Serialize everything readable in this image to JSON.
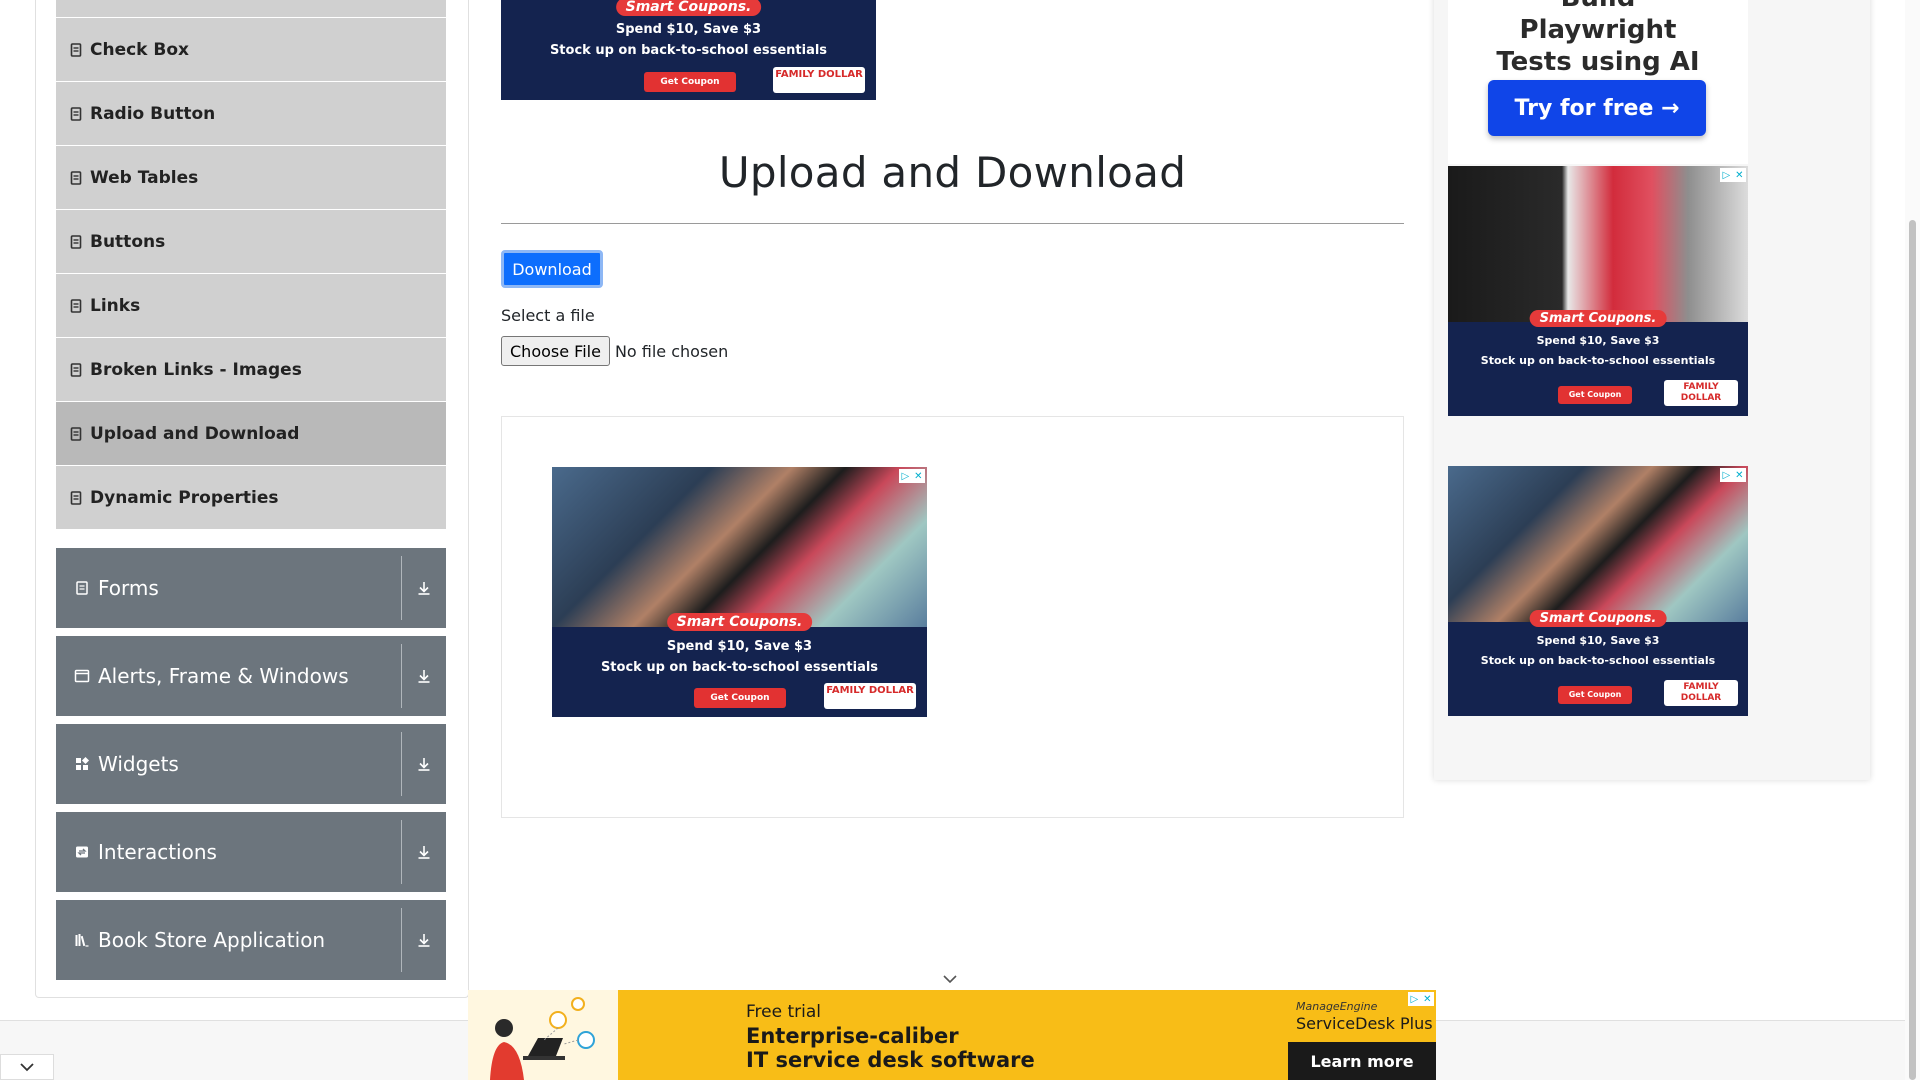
{
  "sidebar": {
    "elements_items": [
      {
        "label": "",
        "active": false
      },
      {
        "label": "Check Box",
        "active": false
      },
      {
        "label": "Radio Button",
        "active": false
      },
      {
        "label": "Web Tables",
        "active": false
      },
      {
        "label": "Buttons",
        "active": false
      },
      {
        "label": "Links",
        "active": false
      },
      {
        "label": "Broken Links - Images",
        "active": false
      },
      {
        "label": "Upload and Download",
        "active": true
      },
      {
        "label": "Dynamic Properties",
        "active": false
      }
    ],
    "groups": [
      {
        "label": "Forms",
        "icon": "form-icon"
      },
      {
        "label": "Alerts, Frame & Windows",
        "icon": "window-icon"
      },
      {
        "label": "Widgets",
        "icon": "widgets-icon"
      },
      {
        "label": "Interactions",
        "icon": "interactions-icon"
      },
      {
        "label": "Book Store Application",
        "icon": "books-icon"
      }
    ]
  },
  "main": {
    "title": "Upload and Download",
    "download_button": "Download",
    "select_label": "Select a file",
    "choose_file": "Choose File",
    "no_file": "No file chosen"
  },
  "ads": {
    "coupon_pill": "Smart Coupons.",
    "spend_line": "Spend $10, Save $3",
    "stock_line": "Stock up on back-to-school essentials",
    "get_coupon": "Get Coupon",
    "logo_text": "FAMILY DOLLAR"
  },
  "right_promo": {
    "headline": "Build Playwright Tests using AI",
    "button": "Try for free →"
  },
  "bottom_ad": {
    "free_trial": "Free trial",
    "headline_line1": "Enterprise-caliber",
    "headline_line2": "IT service desk software",
    "brand_small": "ManageEngine",
    "brand": "ServiceDesk Plus",
    "cta": "Learn more"
  },
  "colors": {
    "accent": "#0d6efd",
    "sidebar_item": "#d0d0d0",
    "sidebar_active": "#b9b9b9",
    "group_bg": "#6c757d"
  }
}
